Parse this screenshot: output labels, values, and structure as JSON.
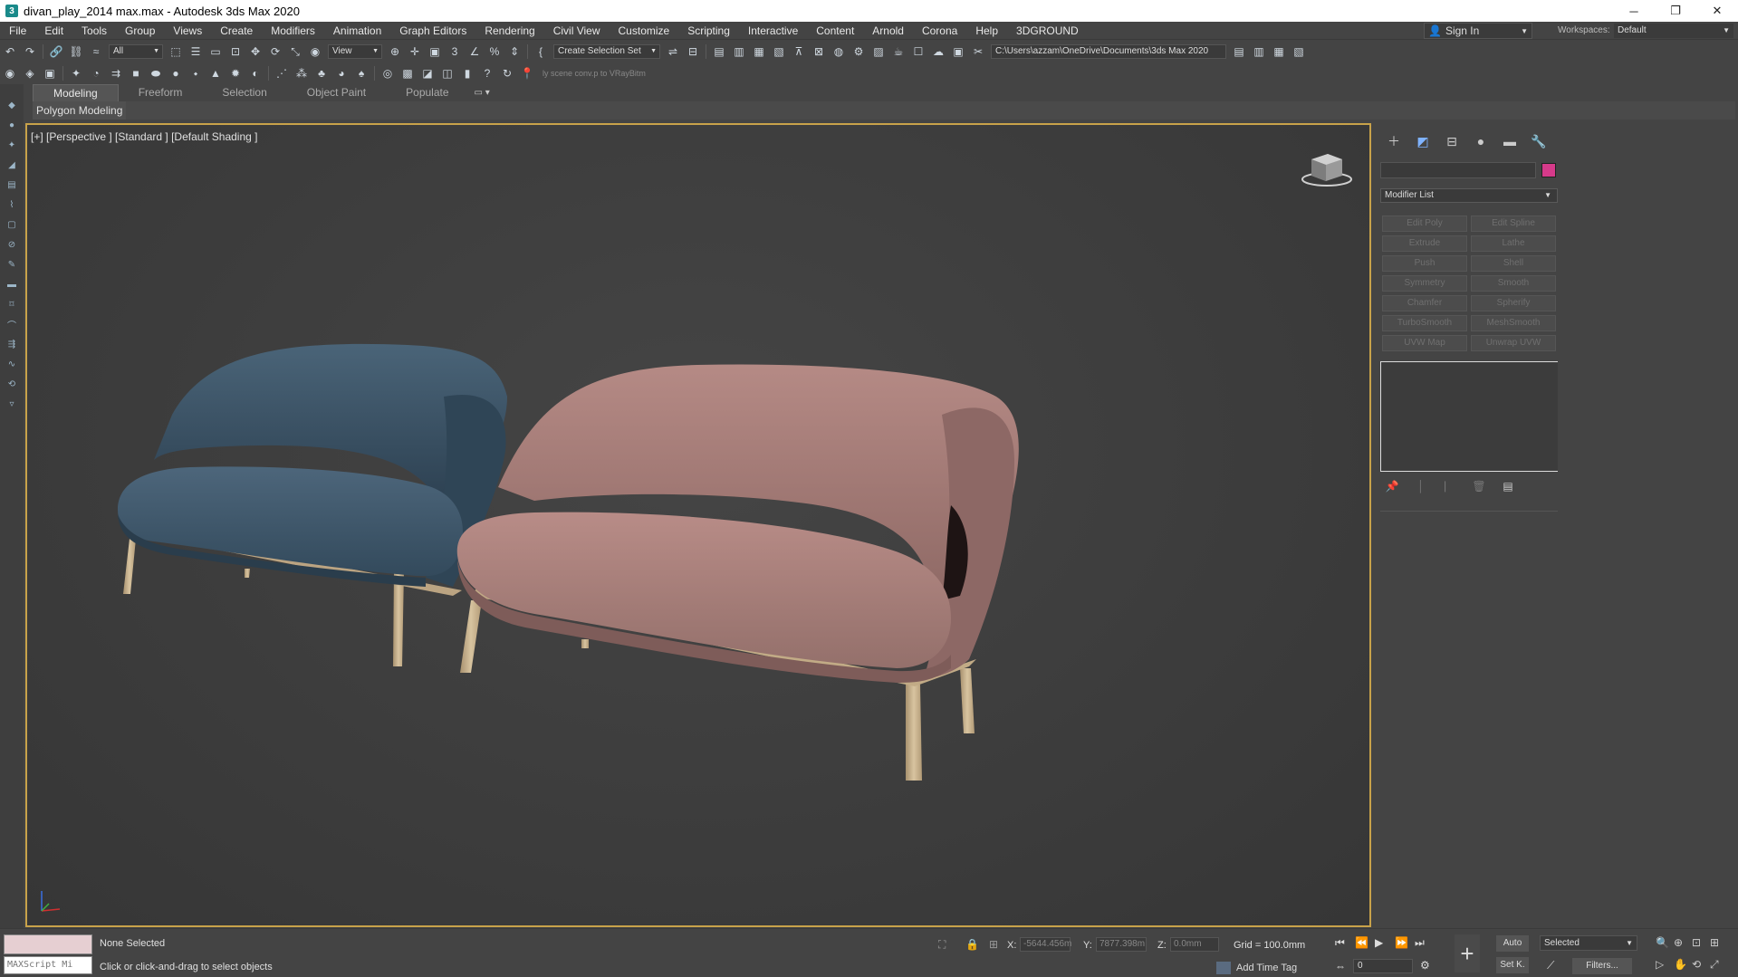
{
  "window": {
    "title": "divan_play_2014 max.max - Autodesk 3ds Max 2020",
    "app_icon": "3",
    "controls": [
      "─",
      "❐",
      "✕"
    ]
  },
  "menu": [
    "File",
    "Edit",
    "Tools",
    "Group",
    "Views",
    "Create",
    "Modifiers",
    "Animation",
    "Graph Editors",
    "Rendering",
    "Civil View",
    "Customize",
    "Scripting",
    "Interactive",
    "Content",
    "Arnold",
    "Corona",
    "Help",
    "3DGROUND"
  ],
  "account": {
    "sign_in": "Sign In",
    "workspaces_label": "Workspaces:",
    "workspace": "Default"
  },
  "toolbar": {
    "filter": "All",
    "ref_coord": "View",
    "selection_set": "Create Selection Set",
    "project_path": "C:\\Users\\azzam\\OneDrive\\Documents\\3ds Max 2020",
    "hint": "ly scene conv.p to VRayBitm"
  },
  "ribbon": {
    "tabs": [
      "Modeling",
      "Freeform",
      "Selection",
      "Object Paint",
      "Populate"
    ],
    "active_tab": "Modeling",
    "panel_label": "Polygon Modeling"
  },
  "viewport": {
    "label": "[+] [Perspective ] [Standard ] [Default Shading ]",
    "objects": [
      {
        "name": "sofa-blue",
        "color": "#3e5568"
      },
      {
        "name": "sofa-pink",
        "color": "#a67a76"
      }
    ],
    "legs_color": "#c8b391",
    "border_color": "#c8a24a"
  },
  "command_panel": {
    "object_color": "#d63a8a",
    "modifier_list": "Modifier List",
    "modifier_buttons": [
      "Edit Poly",
      "Edit Spline",
      "Extrude",
      "Lathe",
      "Push",
      "Shell",
      "Symmetry",
      "Smooth",
      "Chamfer",
      "Spherify",
      "TurboSmooth",
      "MeshSmooth",
      "UVW Map",
      "Unwrap UVW"
    ]
  },
  "status": {
    "maxscript": "MAXScript Mi",
    "selection": "None Selected",
    "prompt": "Click or click-and-drag to select objects",
    "x_label": "X:",
    "x_value": "-5644.456m",
    "y_label": "Y:",
    "y_value": "7877.398m",
    "z_label": "Z:",
    "z_value": "0.0mm",
    "grid": "Grid = 100.0mm",
    "time_tag": "Add Time Tag",
    "frame": "0",
    "auto_key": "Auto",
    "set_key": "Set K.",
    "key_filter": "Selected",
    "filters": "Filters..."
  }
}
